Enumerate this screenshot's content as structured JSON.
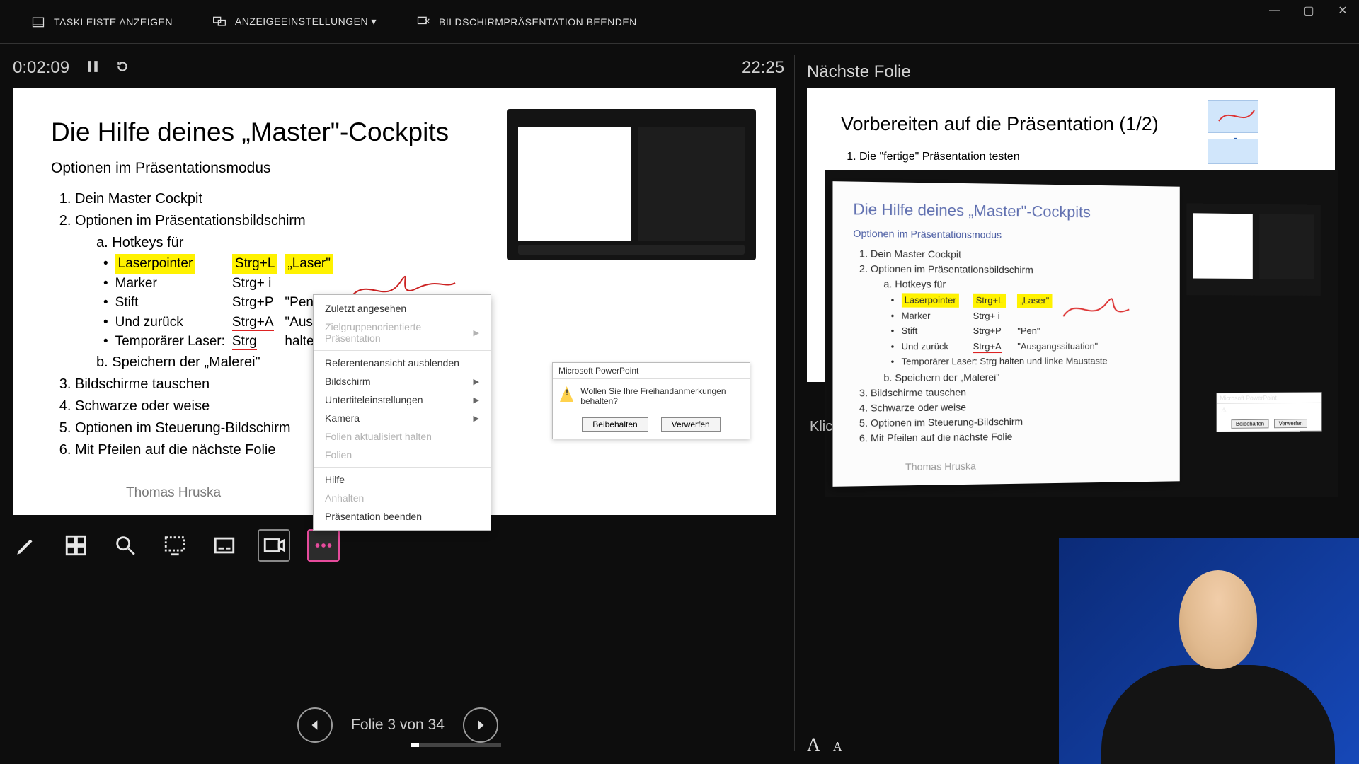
{
  "topbar": {
    "show_taskbar": "TASKLEISTE ANZEIGEN",
    "display_settings": "ANZEIGEEINSTELLUNGEN ▾",
    "end_show": "BILDSCHIRMPRÄSENTATION BEENDEN"
  },
  "timer": {
    "elapsed": "0:02:09",
    "clock": "22:25"
  },
  "slide": {
    "title": "Die Hilfe deines „Master\"-Cockpits",
    "subtitle": "Optionen im Präsentationsmodus",
    "item1": "Dein Master Cockpit",
    "item2": "Optionen im Präsentationsbildschirm",
    "hot_label": "Hotkeys für",
    "hk_laser": "Laserpointer",
    "hk_laser_k": "Strg+L",
    "hk_laser_n": "„Laser\"",
    "hk_marker": "Marker",
    "hk_marker_k": "Strg+ i",
    "hk_pen": "Stift",
    "hk_pen_k": "Strg+P",
    "hk_pen_n": "\"Pen\"",
    "hk_back": "Und zurück",
    "hk_back_k": "Strg+A",
    "hk_back_n": "\"Ausg",
    "hk_temp": "Temporärer Laser:",
    "hk_temp_k": "Strg",
    "hk_temp_n": "halte",
    "save_label": "Speichern der „Malerei\"",
    "item3": "Bildschirme tauschen",
    "item4": "Schwarze oder weise",
    "item5": "Optionen im Steuerung-Bildschirm",
    "item6": "Mit Pfeilen auf die nächste Folie",
    "author": "Thomas Hruska"
  },
  "dialog": {
    "title": "Microsoft PowerPoint",
    "message": "Wollen Sie Ihre Freihandanmerkungen behalten?",
    "keep": "Beibehalten",
    "discard": "Verwerfen"
  },
  "context_menu": {
    "last_viewed": "Zuletzt angesehen",
    "audience": "Zielgruppenorientierte Präsentation",
    "hide_presenter": "Referentenansicht ausblenden",
    "screen": "Bildschirm",
    "subtitles": "Untertiteleinstellungen",
    "camera": "Kamera",
    "keep_updated": "Folien aktualisiert halten",
    "slides": "Folien",
    "help": "Hilfe",
    "pause": "Anhalten",
    "end": "Präsentation beenden"
  },
  "nav": {
    "slide_counter": "Folie 3 von 34",
    "current": 3,
    "total": 34
  },
  "right": {
    "heading": "Nächste Folie",
    "next_title": "Vorbereiten auf die Präsentation (1/2)",
    "next_item1": "Die \"fertige\" Präsentation testen",
    "notes_hint": "Klic"
  },
  "overlay_slide": {
    "title": "Die Hilfe deines „Master\"-Cockpits",
    "subtitle": "Optionen im Präsentationsmodus",
    "item1": "Dein Master Cockpit",
    "item2": "Optionen im Präsentationsbildschirm",
    "hot_label": "Hotkeys für",
    "hk_laser": "Laserpointer",
    "hk_laser_k": "Strg+L",
    "hk_laser_n": "„Laser\"",
    "hk_marker": "Marker",
    "hk_marker_k": "Strg+ i",
    "hk_pen": "Stift",
    "hk_pen_k": "Strg+P",
    "hk_pen_n": "\"Pen\"",
    "hk_back": "Und zurück",
    "hk_back_k": "Strg+A",
    "hk_back_n": "\"Ausgangssituation\"",
    "hk_temp": "Temporärer Laser:   Strg halten und linke Maustaste",
    "save_label": "Speichern der „Malerei\"",
    "item3": "Bildschirme tauschen",
    "item4": "Schwarze oder weise",
    "item5": "Optionen im Steuerung-Bildschirm",
    "item6": "Mit Pfeilen auf die nächste Folie",
    "author": "Thomas Hruska",
    "dlg_title": "Microsoft PowerPoint",
    "dlg_keep": "Beibehalten",
    "dlg_discard": "Verwerfen"
  }
}
